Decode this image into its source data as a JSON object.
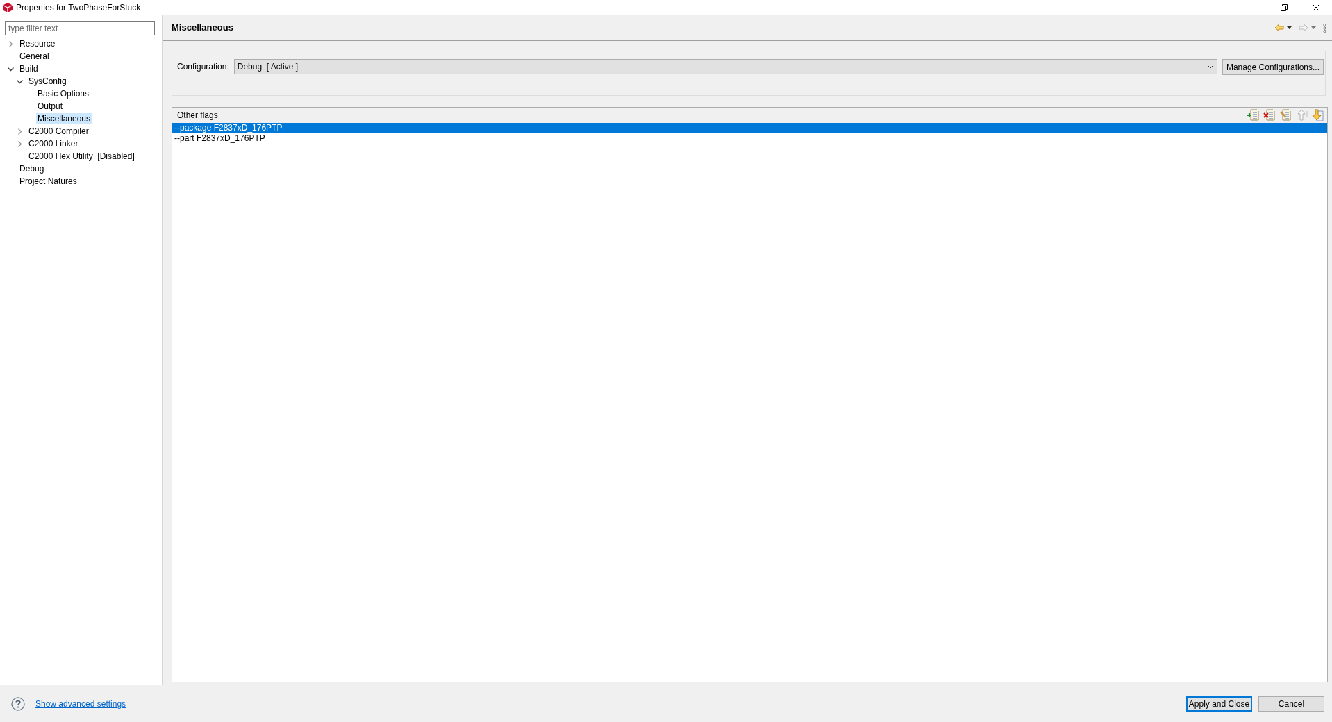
{
  "window": {
    "title": "Properties for TwoPhaseForStuck"
  },
  "filter": {
    "placeholder": "type filter text"
  },
  "tree": [
    {
      "label": "Resource",
      "selected": false,
      "expanded": false
    },
    {
      "label": "General",
      "selected": false
    },
    {
      "label": "Build",
      "selected": false,
      "expanded": true,
      "children": [
        {
          "label": "SysConfig",
          "selected": false,
          "expanded": true,
          "children": [
            {
              "label": "Basic Options",
              "selected": false
            },
            {
              "label": "Output",
              "selected": false
            },
            {
              "label": "Miscellaneous",
              "selected": true
            }
          ]
        },
        {
          "label": "C2000 Compiler",
          "selected": false,
          "expanded": false
        },
        {
          "label": "C2000 Linker",
          "selected": false,
          "expanded": false
        },
        {
          "label": "C2000 Hex Utility  [Disabled]",
          "selected": false
        }
      ]
    },
    {
      "label": "Debug",
      "selected": false
    },
    {
      "label": "Project Natures",
      "selected": false
    }
  ],
  "page": {
    "title": "Miscellaneous"
  },
  "configuration": {
    "label": "Configuration:",
    "value": "Debug  [ Active ]",
    "button": "Manage Configurations..."
  },
  "flags": {
    "title": "Other flags",
    "rows": [
      {
        "text": "--package F2837xD_176PTP",
        "selected": true
      },
      {
        "text": "--part F2837xD_176PTP",
        "selected": false
      }
    ]
  },
  "footer": {
    "link": "Show advanced settings",
    "buttons": [
      {
        "label": "Apply and Close",
        "default": true
      },
      {
        "label": "Cancel",
        "default": false
      }
    ]
  }
}
